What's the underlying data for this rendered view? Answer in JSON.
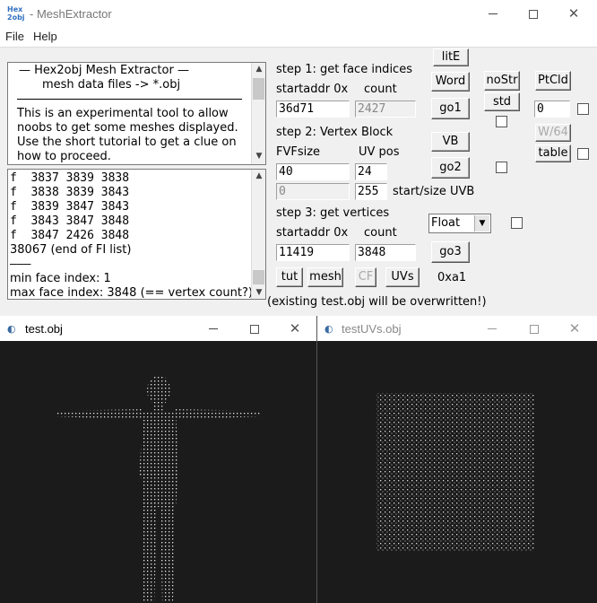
{
  "main": {
    "title": "- MeshExtractor",
    "icon_lines": [
      "Hex",
      "2obj"
    ],
    "menu": [
      "File",
      "Help"
    ],
    "window_controls": {
      "minimize": "—",
      "maximize": "☐",
      "close": "✕"
    }
  },
  "info_box": {
    "line1": "—   Hex2obj Mesh Extractor   —",
    "line2": "mesh data files -> *.obj",
    "text": [
      "This is an experimental tool to allow",
      "noobs to get some meshes displayed.",
      "Use the short tutorial to get a clue on",
      "how to proceed."
    ]
  },
  "face_list": {
    "lines": [
      "f  3837 3839 3838",
      "f  3838 3839 3843",
      "f  3839 3847 3843",
      "f  3843 3847 3848",
      "f  3847 2426 3848",
      "38067 (end of FI list)",
      "———",
      "min face index: 1",
      "max face index: 3848 (== vertex count?)"
    ]
  },
  "step1": {
    "title": "step 1: get face indices",
    "startaddr_label": "startaddr 0x",
    "count_label": "count",
    "startaddr": "36d71",
    "count": "2427",
    "go_label": "go1"
  },
  "step2": {
    "title": "step 2: Vertex Block",
    "fvf_label": "FVFsize",
    "uvpos_label": "UV pos",
    "fvf": "40",
    "uvpos": "24",
    "uvb_start": "0",
    "uvb_size": "255",
    "uvb_label": "start/size UVB",
    "go_label": "go2",
    "vb_label": "VB"
  },
  "step3": {
    "title": "step 3: get vertices",
    "startaddr_label": "startaddr 0x",
    "count_label": "count",
    "startaddr": "11419",
    "count": "3848",
    "type": "Float",
    "go_label": "go3"
  },
  "bottom": {
    "tut": "tut",
    "mesh": "mesh",
    "cf": "CF",
    "uvs": "UVs",
    "hex": "0xa1",
    "warning": "(existing test.obj will be overwritten!)"
  },
  "side": {
    "lite": "litE",
    "word": "Word",
    "nostr": "noStr",
    "std": "std",
    "ptcld": "PtCld",
    "ptcld_value": "0",
    "w64": "W/64",
    "table": "table"
  },
  "child1": {
    "title": "test.obj"
  },
  "child2": {
    "title": "testUVs.obj"
  }
}
